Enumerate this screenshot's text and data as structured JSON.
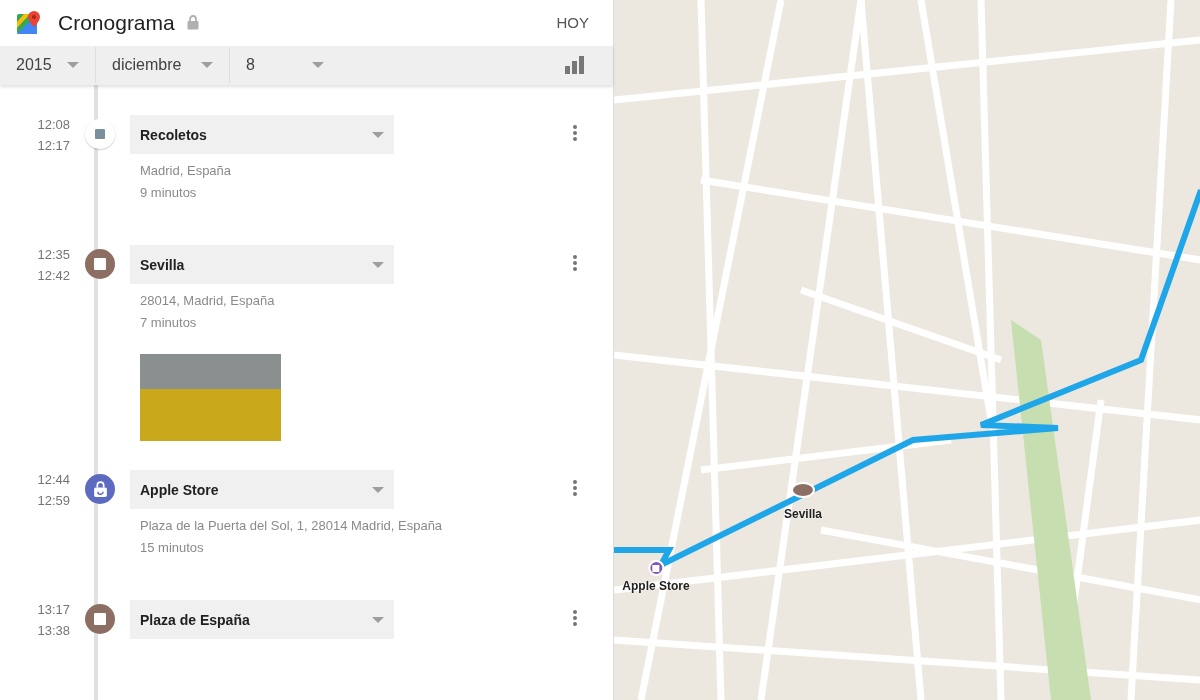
{
  "header": {
    "title": "Cronograma",
    "today_button": "HOY"
  },
  "date_bar": {
    "year": "2015",
    "month": "diciembre",
    "day": "8"
  },
  "stops": [
    {
      "start": "12:08",
      "end": "12:17",
      "name": "Recoletos",
      "address": "Madrid, España",
      "duration": "9 minutos",
      "kind": "ended",
      "color": "#ffffff",
      "photo": false
    },
    {
      "start": "12:35",
      "end": "12:42",
      "name": "Sevilla",
      "address": "28014, Madrid, España",
      "duration": "7 minutos",
      "kind": "place",
      "color": "#8d6e63",
      "photo": true
    },
    {
      "start": "12:44",
      "end": "12:59",
      "name": "Apple Store",
      "address": "Plaza de la Puerta del Sol, 1, 28014 Madrid, España",
      "duration": "15 minutos",
      "kind": "shopping",
      "color": "#5c6bc0",
      "photo": false
    },
    {
      "start": "13:17",
      "end": "13:38",
      "name": "Plaza de España",
      "kind": "place",
      "color": "#8d6e63",
      "photo": false
    }
  ],
  "map": {
    "markers": [
      {
        "label": "Sevilla",
        "kind": "place"
      },
      {
        "label": "Apple Store",
        "kind": "shopping"
      }
    ]
  }
}
